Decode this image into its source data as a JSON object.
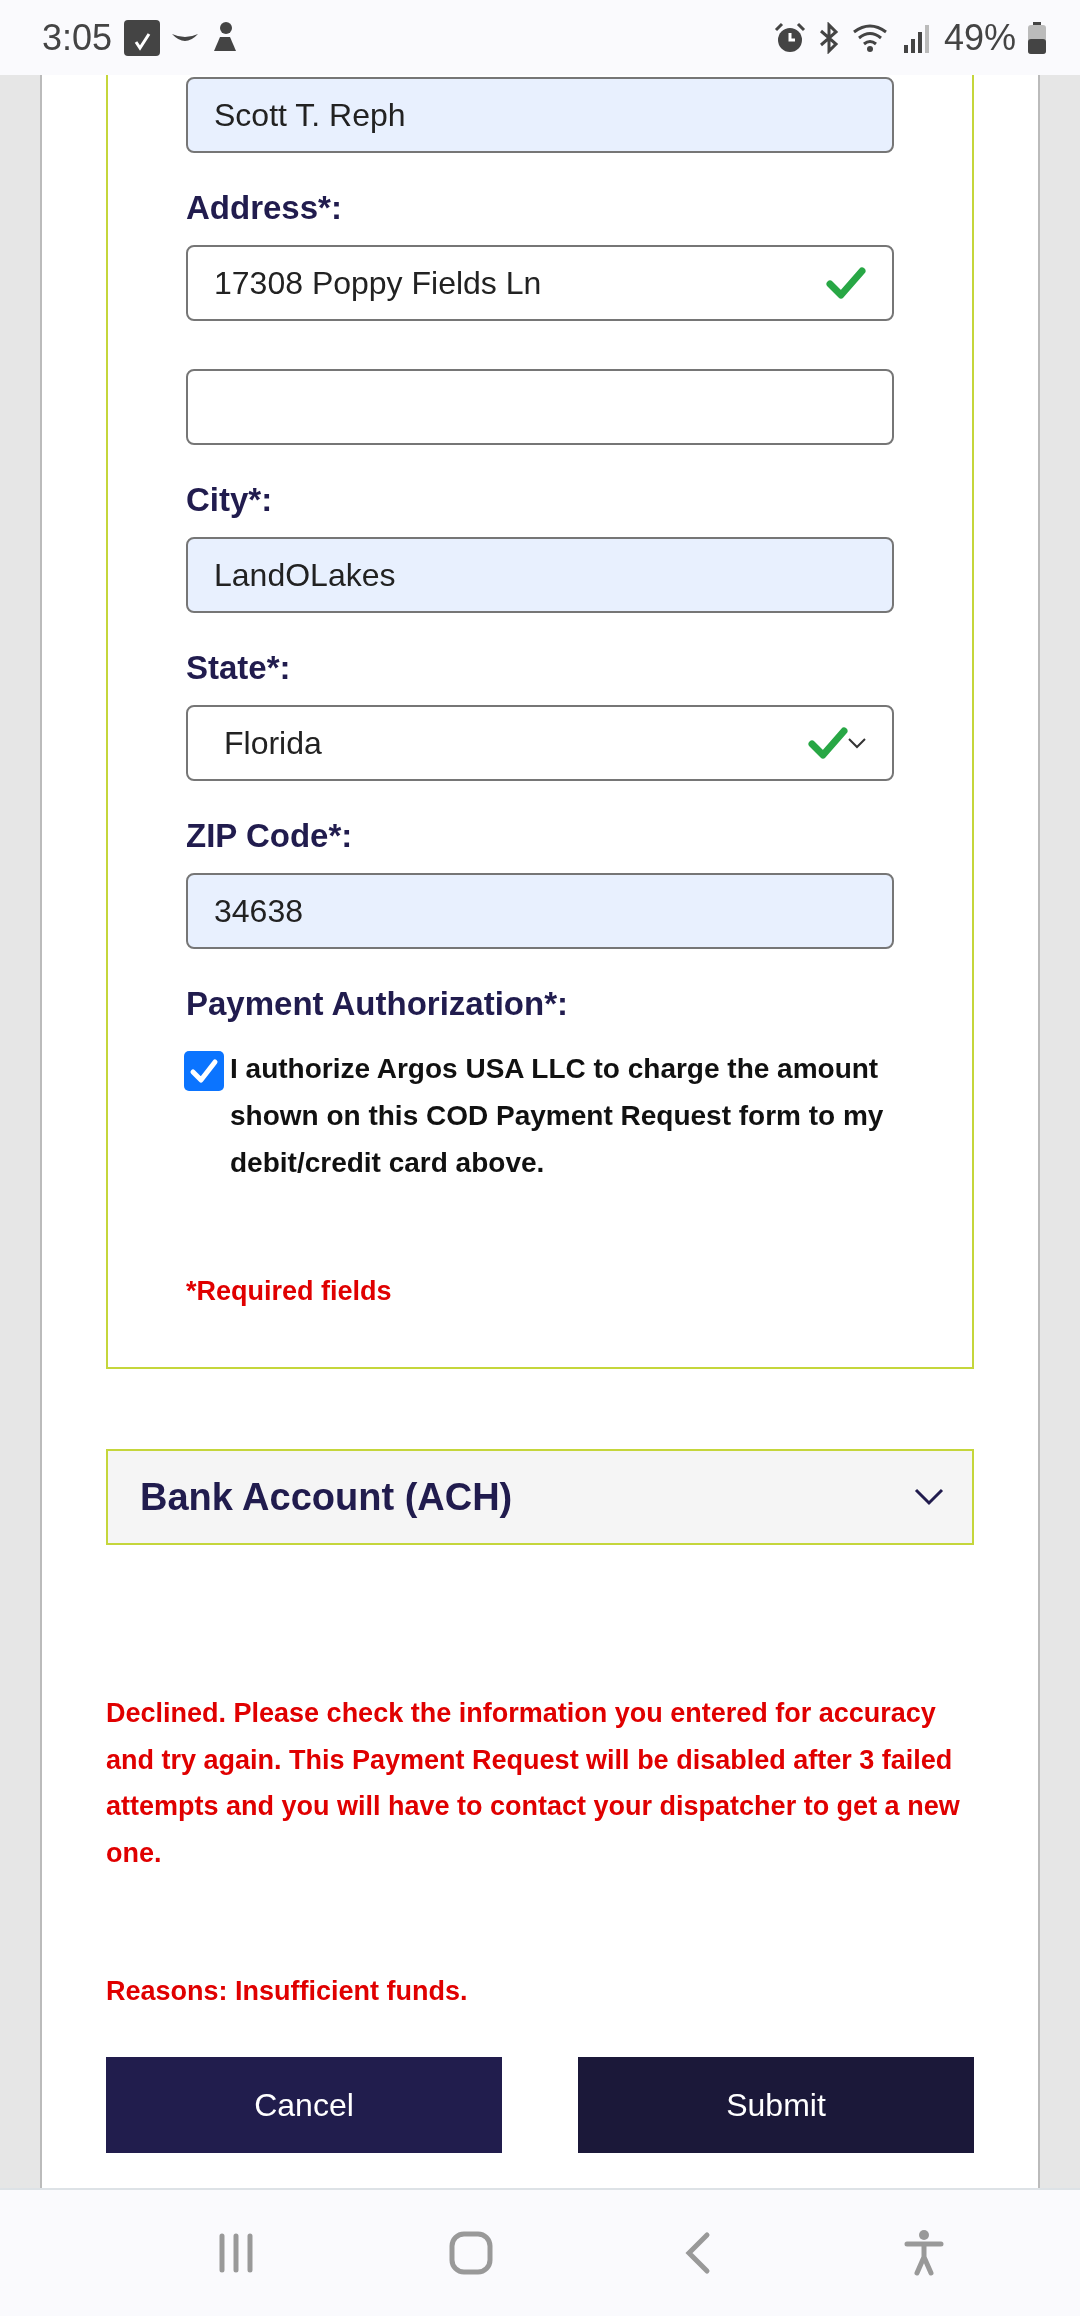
{
  "status_bar": {
    "time": "3:05",
    "battery": "49%"
  },
  "form": {
    "fields": [
      {
        "kind": "text",
        "value": "Scott T. Reph",
        "autofilled": true,
        "valid": false
      },
      {
        "kind": "text",
        "label": "Address*:",
        "value": "17308 Poppy Fields Ln",
        "autofilled": false,
        "valid": true
      },
      {
        "kind": "text",
        "autofilled": false,
        "valid": false
      },
      {
        "kind": "text",
        "label": "City*:",
        "value": "LandOLakes",
        "autofilled": true,
        "valid": false
      },
      {
        "kind": "select",
        "label": "State*:",
        "value": "Florida",
        "autofilled": false,
        "valid": true
      },
      {
        "kind": "text",
        "label": "ZIP Code*:",
        "value": "34638",
        "autofilled": true,
        "valid": false
      }
    ],
    "authorization": {
      "label": "Payment Authorization*:",
      "checked": true,
      "text": "I authorize Argos USA LLC to charge the amount shown on this COD Payment Request form to my debit/credit card above."
    },
    "required_note": "*Required fields"
  },
  "accordion": {
    "title": "Bank Account (ACH)",
    "expanded": false
  },
  "error": {
    "message": "Declined. Please check the information you entered for accuracy and try again. This Payment Request will be disabled after 3 failed attempts and you will have to contact your dispatcher to get a new one.",
    "reasons": "Reasons: Insufficient funds."
  },
  "buttons": [
    {
      "label": "Cancel",
      "kind": "secondary"
    },
    {
      "label": "Submit",
      "kind": "primary"
    }
  ]
}
